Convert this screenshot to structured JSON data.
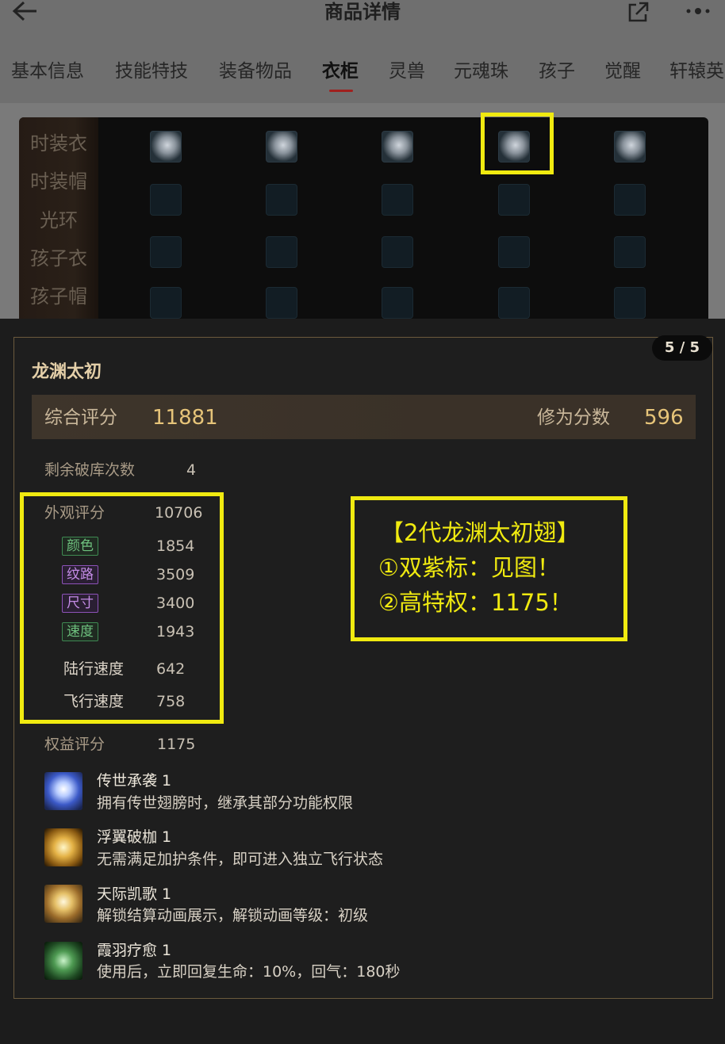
{
  "header": {
    "title": "商品详情",
    "back_icon": "arrow-left-icon",
    "share_icon": "share-icon",
    "more_icon": "more-dots-icon"
  },
  "tabs": [
    {
      "label": "基本信息"
    },
    {
      "label": "技能特技"
    },
    {
      "label": "装备物品"
    },
    {
      "label": "衣柜",
      "active": true
    },
    {
      "label": "灵兽"
    },
    {
      "label": "元魂珠"
    },
    {
      "label": "孩子"
    },
    {
      "label": "觉醒"
    },
    {
      "label": "轩辕英"
    }
  ],
  "wardrobe": {
    "rows": [
      "时装衣",
      "时装帽",
      "光环",
      "孩子衣",
      "孩子帽"
    ],
    "highlighted": {
      "row": 0,
      "col": 3
    }
  },
  "detail": {
    "pager": "5 / 5",
    "item_name": "龙渊太初",
    "overall_label": "综合评分",
    "overall_value": "11881",
    "cultivation_label": "修为分数",
    "cultivation_value": "596",
    "remaining_label": "剩余破库次数",
    "remaining_value": "4",
    "appearance_label": "外观评分",
    "appearance_value": "10706",
    "attrs": [
      {
        "tag": "颜色",
        "value": "1854",
        "color": "green"
      },
      {
        "tag": "纹路",
        "value": "3509",
        "color": "purple"
      },
      {
        "tag": "尺寸",
        "value": "3400",
        "color": "purple"
      },
      {
        "tag": "速度",
        "value": "1943",
        "color": "green"
      }
    ],
    "land_speed_label": "陆行速度",
    "land_speed_value": "642",
    "fly_speed_label": "飞行速度",
    "fly_speed_value": "758",
    "rights_label": "权益评分",
    "rights_value": "1175",
    "skills": [
      {
        "name": "传世承袭 1",
        "desc": "拥有传世翅膀时，继承其部分功能权限",
        "icon": "wing-legacy-icon"
      },
      {
        "name": "浮翼破枷 1",
        "desc": "无需满足加护条件，即可进入独立飞行状态",
        "icon": "golden-wing-icon"
      },
      {
        "name": "天际凯歌 1",
        "desc": "解锁结算动画展示，解锁动画等级：初级",
        "icon": "lightning-wing-icon"
      },
      {
        "name": "霞羽疗愈 1",
        "desc": "使用后，立即回复生命：10%，回气：180秒",
        "icon": "healing-figure-icon"
      }
    ]
  },
  "note": {
    "lines": [
      "【2代龙渊太初翅】",
      "①双紫标：见图！",
      "②高特权：1175！"
    ]
  }
}
